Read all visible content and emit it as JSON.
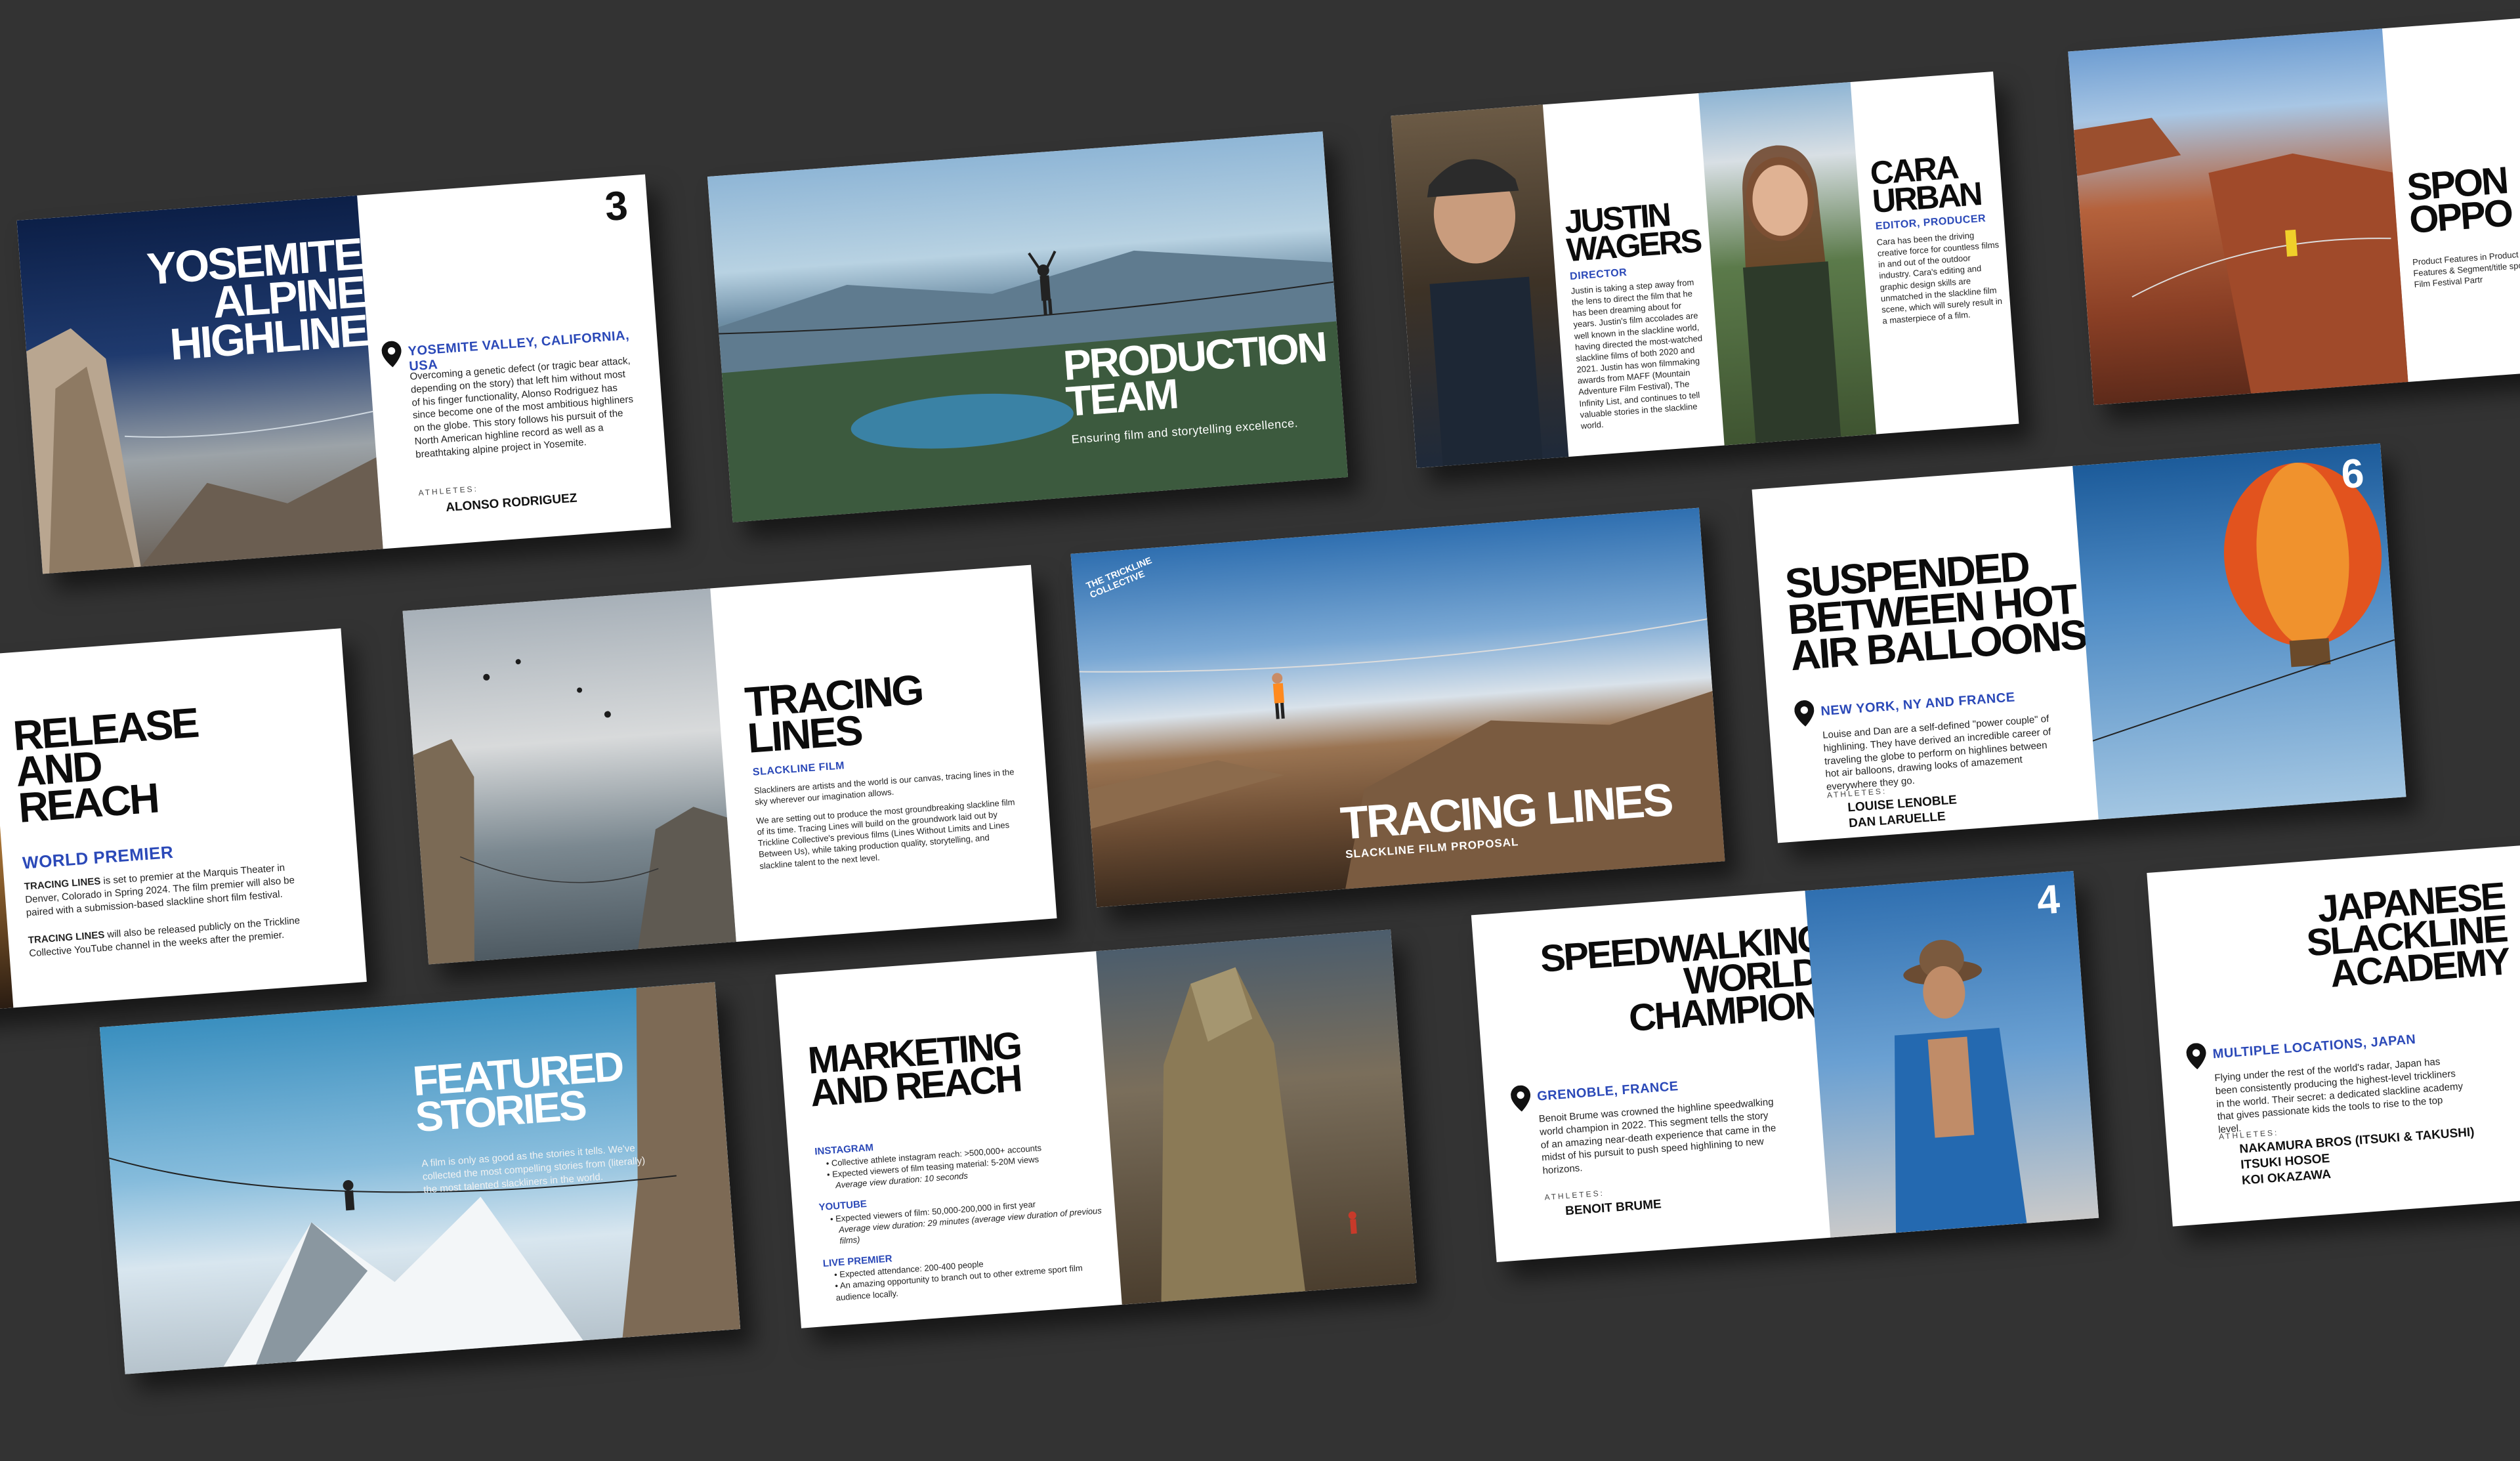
{
  "palette": {
    "background": "#333333",
    "card": "#ffffff",
    "accent_blue": "#2b49b8",
    "headline": "#0c0c0c"
  },
  "cards": {
    "yosemite": {
      "title": "YOSEMITE ALPINE HIGHLINE",
      "number": "3",
      "location": "YOSEMITE VALLEY, CALIFORNIA, USA",
      "body": "Overcoming a genetic defect (or tragic bear attack, depending on the story) that left him without most of his finger functionality, Alonso Rodriguez has since become one of the most ambitious highliners on the globe. This story follows his pursuit of the North American highline record as well as a breathtaking alpine project in Yosemite.",
      "athletes_label": "ATHLETES:",
      "athletes": "ALONSO RODRIGUEZ"
    },
    "production": {
      "title": "PRODUCTION TEAM",
      "subtitle": "Ensuring film and storytelling excellence."
    },
    "team": {
      "justin_name": "JUSTIN WAGERS",
      "justin_role": "DIRECTOR",
      "justin_body": "Justin is taking a step away from the lens to direct the film that he has been dreaming about for years. Justin's film accolades are well known in the slackline world, having directed the most-watched slackline films of both 2020 and 2021. Justin has won filmmaking awards from MAFF (Mountain Adventure Film Festival), The Infinity List, and continues to tell valuable stories in the slackline world.",
      "cara_name": "CARA URBAN",
      "cara_role": "EDITOR, PRODUCER",
      "cara_body": "Cara has been the driving creative force for countless films in and out of the outdoor industry. Cara's editing and graphic design skills are unmatched in the slackline film scene, which will surely result in a masterpiece of a film."
    },
    "sponsor": {
      "title": "SPON OPPO",
      "body": "Product Features in Product Features & Segment/title spon Film Festival Partr"
    },
    "release": {
      "title": "RELEASE AND REACH",
      "subtitle": "WORLD PREMIER",
      "p1_bold": "TRACING LINES",
      "p1": " is set to premier at the Marquis Theater in Denver, Colorado in Spring 2024. The film premier will also be paired with a submission-based slackline short film festival.",
      "p2_bold": "TRACING LINES",
      "p2": " will also be released publicly on the Trickline Collective YouTube channel in the weeks after the premier."
    },
    "tracing_intro": {
      "title": "TRACING LINES",
      "subtitle": "SLACKLINE FILM",
      "p1": "Slackliners are artists and the world is our canvas, tracing lines in the sky wherever our imagination allows.",
      "p2": "We are setting out to produce the most groundbreaking slackline film of its time. Tracing Lines will build on the groundwork laid out by Trickline Collective's previous films (Lines Without Limits and Lines Between Us), while taking production quality, storytelling, and slackline talent to the next level."
    },
    "cover": {
      "logo": "THE TRICKLINE COLLECTIVE",
      "title": "TRACING LINES",
      "subtitle": "SLACKLINE FILM PROPOSAL"
    },
    "balloons": {
      "title": "SUSPENDED BETWEEN HOT AIR BALLOONS",
      "number": "6",
      "location": "NEW YORK, NY AND FRANCE",
      "body": "Louise and Dan are a self-defined \"power couple\" of highlining. They have derived an incredible career of traveling the globe to perform on highlines between hot air balloons, drawing looks of amazement everywhere they go.",
      "athletes_label": "ATHLETES:",
      "athletes": [
        "LOUISE LENOBLE",
        "DAN LARUELLE"
      ]
    },
    "featured": {
      "title": "FEATURED STORIES",
      "body": "A film is only as good as the stories it tells. We've collected the most compelling stories from (literally) the most talented slackliners in the world."
    },
    "marketing": {
      "title": "MARKETING AND REACH",
      "instagram_h": "INSTAGRAM",
      "instagram_1": "• Collective athlete instagram reach: >500,000+ accounts",
      "instagram_2": "• Expected viewers of film teasing material: 5-20M views",
      "instagram_3": "Average view duration: 10 seconds",
      "youtube_h": "YOUTUBE",
      "youtube_1": "• Expected viewers of film: 50,000-200,000 in first year",
      "youtube_2": "Average view duration: 29 minutes (average view duration of previous films)",
      "live_h": "LIVE PREMIER",
      "live_1": "• Expected attendance: 200-400 people",
      "live_2": "• An amazing opportunity to branch out to other extreme sport film audience locally."
    },
    "speedwalking": {
      "title": "SPEEDWALKING WORLD CHAMPION",
      "number": "4",
      "location": "GRENOBLE, FRANCE",
      "body": "Benoit Brume was crowned the highline speedwalking world champion in 2022. This segment tells the story of an amazing near-death experience that came in the midst of his pursuit to push speed highlining to new horizons.",
      "athletes_label": "ATHLETES:",
      "athletes": "BENOIT BRUME"
    },
    "japanese": {
      "title": "JAPANESE SLACKLINE ACADEMY",
      "location": "MULTIPLE LOCATIONS, JAPAN",
      "body": "Flying under the rest of the world's radar, Japan has been consistently producing the highest-level trickliners in the world. Their secret: a dedicated slackline academy that gives passionate kids the tools to rise to the top level.",
      "athletes_label": "ATHLETES:",
      "athletes": [
        "NAKAMURA BROS (ITSUKI & TAKUSHI)",
        "ITSUKI HOSOE",
        "KOI OKAZAWA"
      ]
    }
  }
}
